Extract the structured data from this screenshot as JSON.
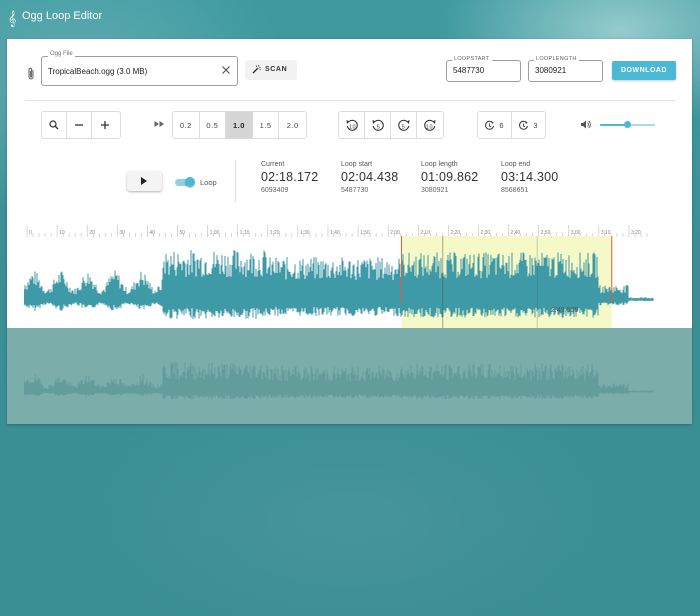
{
  "app": {
    "title": "Ogg Loop Editor",
    "icon": "treble-clef-icon"
  },
  "file": {
    "label": "Ogg File",
    "value": "TropicalBeach.ogg (3.0 MB)"
  },
  "scan": {
    "label": "SCAN"
  },
  "loopstart": {
    "label": "LOOPSTART",
    "value": "5487730"
  },
  "looplength": {
    "label": "LOOPLENGTH",
    "value": "3080921"
  },
  "download": {
    "label": "DOWNLOAD"
  },
  "rates": [
    "0.2",
    "0.5",
    "1.0",
    "1.5",
    "2.0"
  ],
  "active_rate": "1.0",
  "seek": [
    "10",
    "5",
    "5",
    "10"
  ],
  "timers": [
    "6",
    "3"
  ],
  "volume": 0.5,
  "loop_toggle": {
    "label": "Loop",
    "on": true
  },
  "times": {
    "current": {
      "label": "Current",
      "value": "02:18.172",
      "sample": "6093409"
    },
    "start": {
      "label": "Loop start",
      "value": "02:04.438",
      "sample": "5487730"
    },
    "length": {
      "label": "Loop length",
      "value": "01:09.862",
      "sample": "3080921"
    },
    "end": {
      "label": "Loop end",
      "value": "03:14.300",
      "sample": "8568651"
    }
  },
  "timeline": {
    "ticks": [
      "0",
      "10",
      "20",
      "30",
      "40",
      "50",
      "1:00",
      "1:10",
      "1:20",
      "1:30",
      "1:40",
      "1:50",
      "2:00",
      "2:10",
      "2:20",
      "2:30",
      "2:40",
      "2:50",
      "3:00",
      "3:10",
      "3:20"
    ],
    "duration_s": 206,
    "loop_start_s": 124.438,
    "loop_end_s": 194.3,
    "cursor_s": 138.172,
    "hover_s": 169.505,
    "hover_label": "2:49.505"
  },
  "colors": {
    "accent": "#4bb8d4",
    "wave": "#3f9aa8",
    "selection": "#f4f8c4",
    "loop_marker": "#e25c3a"
  }
}
